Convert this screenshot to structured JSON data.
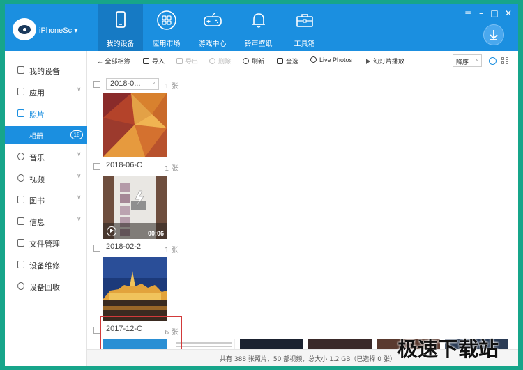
{
  "device": {
    "name": "iPhoneSc"
  },
  "nav": [
    {
      "label": "我的设备",
      "icon": "phone-icon",
      "active": true
    },
    {
      "label": "应用市场",
      "icon": "apps-icon",
      "active": false
    },
    {
      "label": "游戏中心",
      "icon": "gamepad-icon",
      "active": false
    },
    {
      "label": "铃声壁纸",
      "icon": "bell-icon",
      "active": false
    },
    {
      "label": "工具箱",
      "icon": "toolbox-icon",
      "active": false
    }
  ],
  "window_controls": {
    "menu": "≡",
    "minimize": "–",
    "maximize": "□",
    "close": "✕"
  },
  "sidebar": {
    "items": [
      {
        "label": "我的设备",
        "icon": "device-icon"
      },
      {
        "label": "应用",
        "icon": "apps-grid-icon",
        "chevron": "∨"
      },
      {
        "label": "照片",
        "icon": "photo-icon"
      },
      {
        "label": "相册",
        "count": "18"
      },
      {
        "label": "音乐",
        "icon": "music-icon",
        "chevron": "∨"
      },
      {
        "label": "视频",
        "icon": "video-icon",
        "chevron": "∨"
      },
      {
        "label": "图书",
        "icon": "book-icon",
        "chevron": "∨"
      },
      {
        "label": "信息",
        "icon": "message-icon",
        "chevron": "∨"
      },
      {
        "label": "文件管理",
        "icon": "folder-icon"
      },
      {
        "label": "设备维修",
        "icon": "repair-icon"
      },
      {
        "label": "设备回收",
        "icon": "recycle-icon"
      }
    ]
  },
  "toolbar": {
    "all_albums": "← 全部相簿",
    "import": "导入",
    "export": "导出",
    "delete": "删除",
    "refresh": "刷新",
    "select_all": "全选",
    "live_photos": "Live Photos",
    "slideshow": "幻灯片播放",
    "sort": "降序",
    "sort_arrow": "∨"
  },
  "groups": [
    {
      "date": "2018-0...",
      "count": "1 张",
      "dropdown": "∨"
    },
    {
      "date": "2018-06-C",
      "count": "1 张",
      "duration": "00:06"
    },
    {
      "date": "2018-02-2",
      "count": "1 张"
    },
    {
      "date": "2017-12-C",
      "count": "6 张"
    }
  ],
  "status": "共有 388 张照片，50 部视频，总大小 1.2 GB（已选择 0 张）",
  "watermark": "极速下载站",
  "colors": {
    "accent": "#1b8fe0",
    "frame": "#17a58a",
    "highlight": "#d23a3a"
  }
}
